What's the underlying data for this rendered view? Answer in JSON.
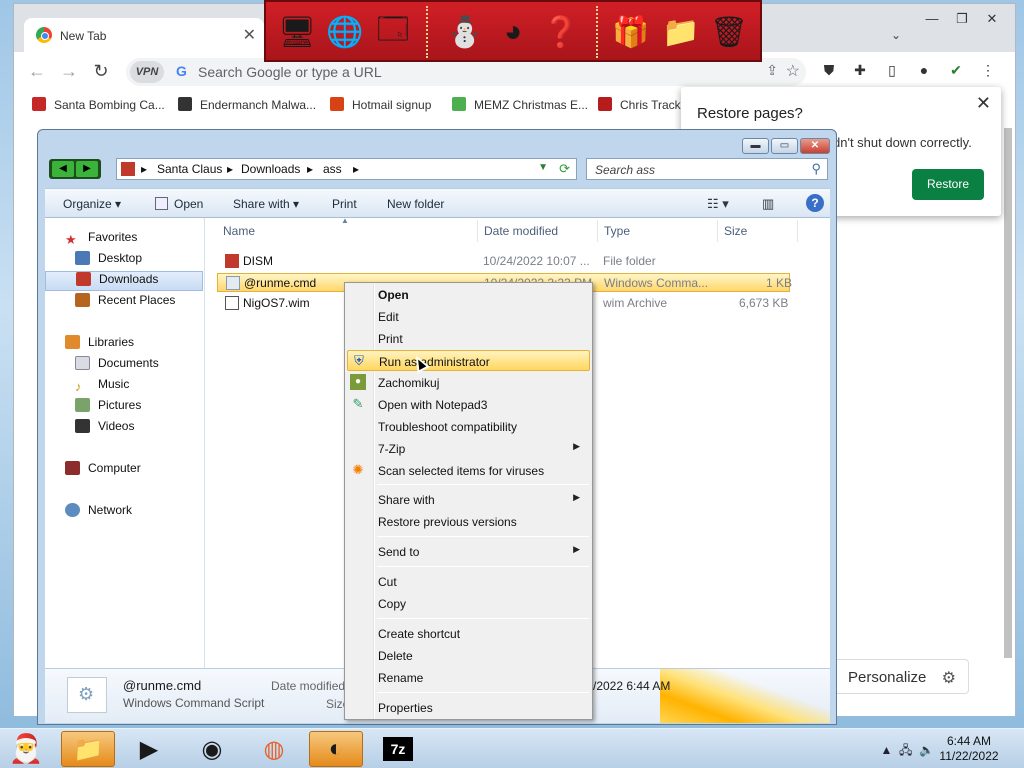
{
  "chrome": {
    "tab_title": "New Tab",
    "tab_close": "✕",
    "omnibox_placeholder": "Search Google or type a URL",
    "vpn_label": "VPN",
    "bookmarks": [
      {
        "label": "Santa Bombing Ca...",
        "color": "#c62828"
      },
      {
        "label": "Endermanch Malwa...",
        "color": "#333333"
      },
      {
        "label": "Hotmail signup",
        "color": "#d84315"
      },
      {
        "label": "MEMZ Christmas E...",
        "color": "#4caf50"
      },
      {
        "label": "Chris Tracke",
        "color": "#b71c1c"
      }
    ],
    "restore_popup": {
      "title": "Restore pages?",
      "message": "dn't shut down correctly.",
      "button": "Restore",
      "button_color": "#0b8043"
    },
    "personalize_label": "Personalize"
  },
  "explorer": {
    "breadcrumb": [
      "Santa Claus",
      "Downloads",
      "ass"
    ],
    "search_placeholder": "Search ass",
    "commands": [
      "Organize",
      "Open",
      "Share with",
      "Print",
      "New folder"
    ],
    "nav": {
      "favorites": "Favorites",
      "desktop": "Desktop",
      "downloads": "Downloads",
      "recent": "Recent Places",
      "libraries": "Libraries",
      "documents": "Documents",
      "music": "Music",
      "pictures": "Pictures",
      "videos": "Videos",
      "computer": "Computer",
      "network": "Network"
    },
    "columns": [
      "Name",
      "Date modified",
      "Type",
      "Size"
    ],
    "files": [
      {
        "name": "DISM",
        "date": "10/24/2022 10:07 ...",
        "type": "File folder",
        "size": ""
      },
      {
        "name": "@runme.cmd",
        "date": "10/24/2022 2:23 PM",
        "type": "Windows Comma...",
        "size": "1 KB"
      },
      {
        "name": "NigOS7.wim",
        "date": "",
        "type": "wim Archive",
        "size": "6,673 KB"
      }
    ],
    "details": {
      "name": "@runme.cmd",
      "type": "Windows Command Script",
      "date_label": "Date modified",
      "date_value": "/2022 6:44 AM",
      "size_label": "Size"
    }
  },
  "context_menu": {
    "items": [
      {
        "label": "Open"
      },
      {
        "label": "Edit"
      },
      {
        "label": "Print"
      },
      {
        "label": "Run as administrator"
      },
      {
        "label": "Zachomikuj"
      },
      {
        "label": "Open with Notepad3"
      },
      {
        "label": "Troubleshoot compatibility"
      },
      {
        "label": "7-Zip"
      },
      {
        "label": "Scan selected items for viruses"
      },
      {
        "label": "Share with"
      },
      {
        "label": "Restore previous versions"
      },
      {
        "label": "Send to"
      },
      {
        "label": "Cut"
      },
      {
        "label": "Copy"
      },
      {
        "label": "Create shortcut"
      },
      {
        "label": "Delete"
      },
      {
        "label": "Rename"
      },
      {
        "label": "Properties"
      }
    ]
  },
  "taskbar": {
    "time": "6:44 AM",
    "date": "11/22/2022",
    "apps": [
      "file-manager",
      "media-player",
      "chrome",
      "firefox",
      "tor-browser",
      "7-zip"
    ],
    "sevenzip_label": "7z"
  },
  "colors": {
    "festive_bar": "#d21f26",
    "selection_yellow": "#ffd75f",
    "restore_green": "#0b8043"
  }
}
